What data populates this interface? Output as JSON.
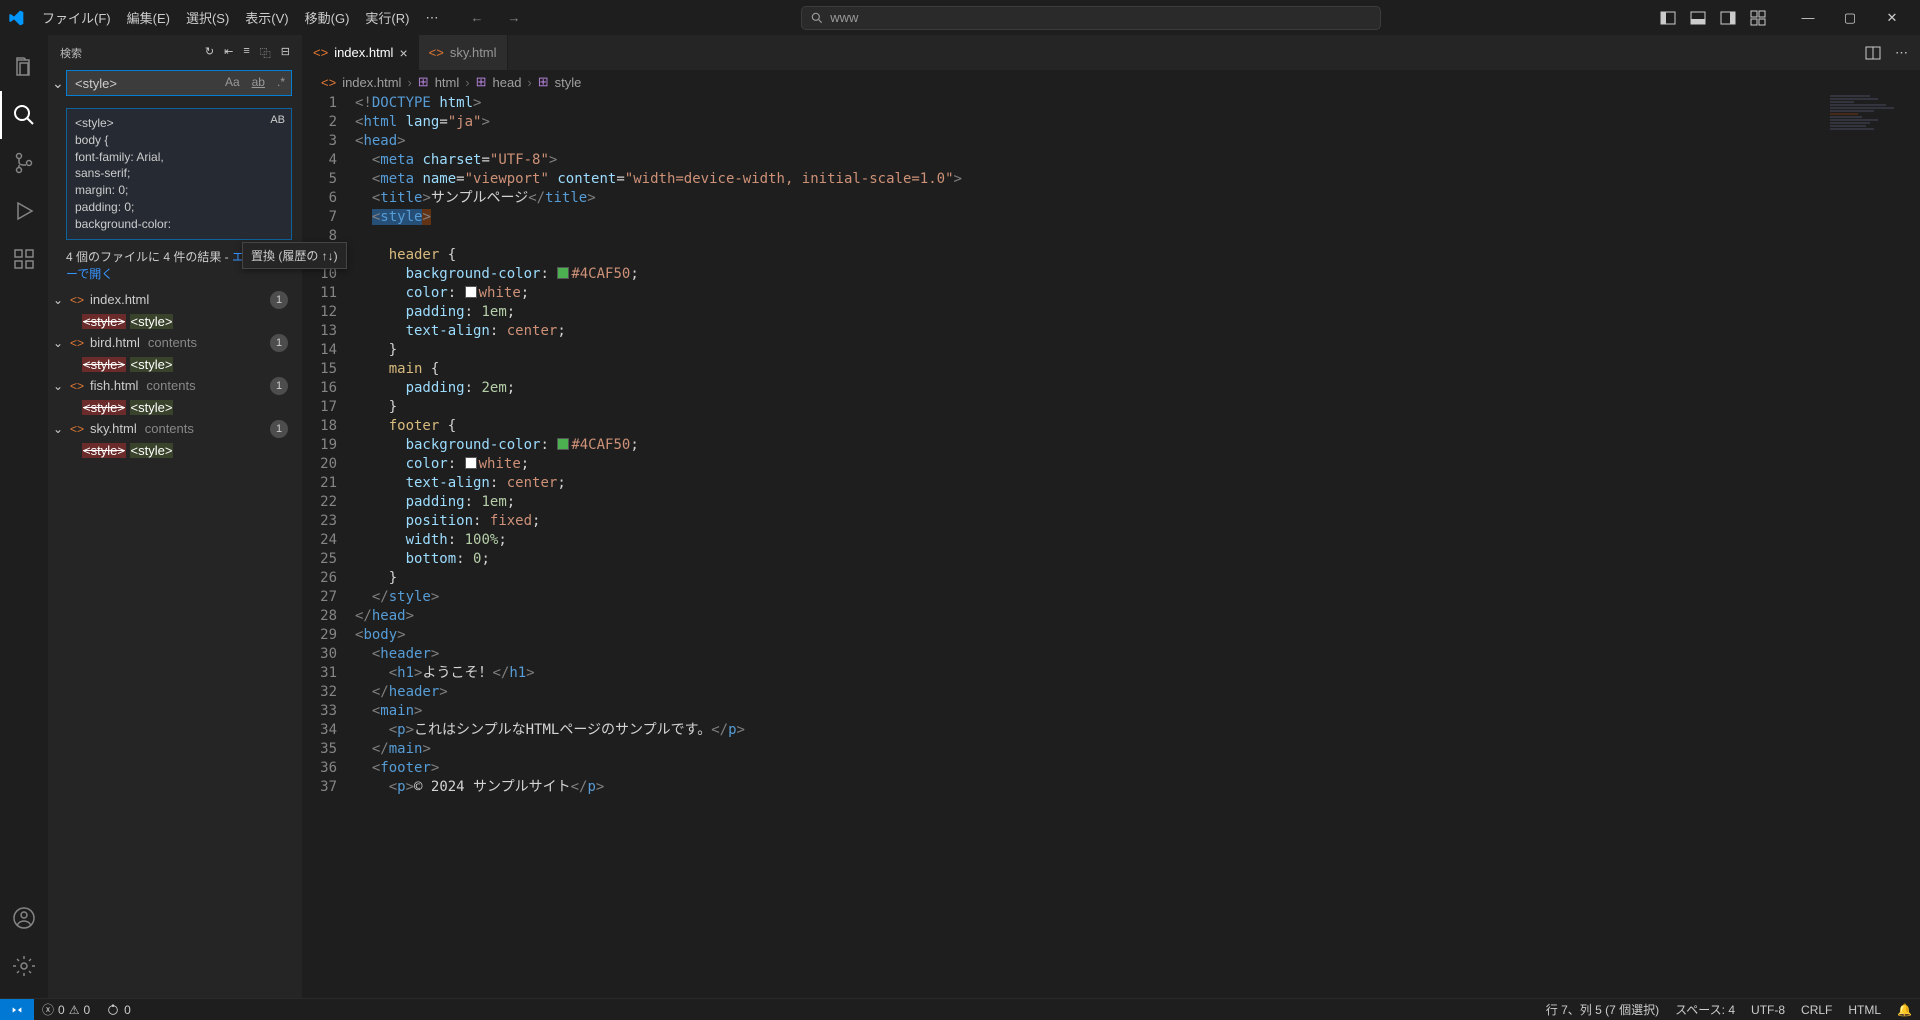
{
  "menu": {
    "file": "ファイル(F)",
    "edit": "編集(E)",
    "select": "選択(S)",
    "view": "表示(V)",
    "go": "移動(G)",
    "run": "実行(R)",
    "more": "⋯"
  },
  "search_top": {
    "text": "www"
  },
  "window": {
    "min": "—",
    "max": "▢",
    "close": "✕"
  },
  "sidebar": {
    "title": "検索",
    "input_value": "<style>",
    "opt_case": "Aa",
    "opt_word": "ab",
    "opt_regex": ".*",
    "replace_preview_lines": [
      "<style>",
      "  body {",
      "    font-family: Arial,",
      "sans-serif;",
      "    margin: 0;",
      "    padding: 0;",
      "    background-color:"
    ],
    "replace_ab": "AB",
    "tooltip": "置換 (履歴の ↑↓)",
    "summary_prefix": "4 個のファイルに 4 件の結果 - ",
    "summary_link": "エディターで開く",
    "results": [
      {
        "name": "index.html",
        "loc": "",
        "count": "1",
        "old": "<style>",
        "new": "<style>"
      },
      {
        "name": "bird.html",
        "loc": "contents",
        "count": "1",
        "old": "<style>",
        "new": "<style>"
      },
      {
        "name": "fish.html",
        "loc": "contents",
        "count": "1",
        "old": "<style>",
        "new": "<style>"
      },
      {
        "name": "sky.html",
        "loc": "contents",
        "count": "1",
        "old": "<style>",
        "new": "<style>"
      }
    ]
  },
  "tabs": [
    {
      "name": "index.html",
      "active": true,
      "close": "×"
    },
    {
      "name": "sky.html",
      "active": false,
      "close": ""
    }
  ],
  "breadcrumb": {
    "file": "index.html",
    "p1": "html",
    "p2": "head",
    "p3": "style"
  },
  "code": {
    "lines": [
      1,
      2,
      3,
      4,
      5,
      6,
      7,
      8,
      9,
      10,
      11,
      12,
      13,
      14,
      15,
      16,
      17,
      18,
      19,
      20,
      21,
      22,
      23,
      24,
      25,
      26,
      27,
      28,
      29,
      30,
      31,
      32,
      33,
      34,
      35,
      36,
      37
    ],
    "title_text": "サンプルページ",
    "color1": "#4CAF50",
    "h1": "ようこそ！",
    "ptext": "これはシンプルなHTMLページのサンプルです。",
    "footer": "© 2024 サンプルサイト"
  },
  "status": {
    "errors": "0",
    "warnings": "0",
    "ports": "0",
    "cursor": "行 7、列 5 (7 個選択)",
    "spaces": "スペース: 4",
    "enc": "UTF-8",
    "eol": "CRLF",
    "lang": "HTML"
  }
}
